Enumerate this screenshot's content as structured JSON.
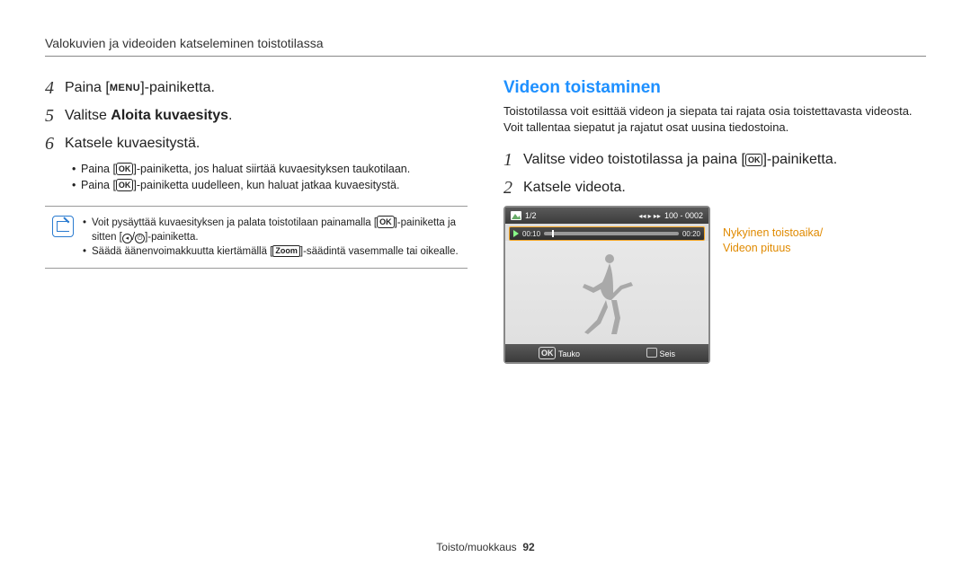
{
  "header": "Valokuvien ja videoiden katseleminen toistotilassa",
  "left": {
    "steps": [
      {
        "num": "4",
        "pre": "Paina [",
        "icon": "MENU",
        "post": "]-painiketta."
      },
      {
        "num": "5",
        "pre": "Valitse ",
        "bold": "Aloita kuvaesitys",
        "post": "."
      },
      {
        "num": "6",
        "text": "Katsele kuvaesitystä."
      }
    ],
    "bullets": [
      {
        "pre": "Paina [",
        "icon": "OK",
        "post": "]-painiketta, jos haluat siirtää kuvaesityksen taukotilaan."
      },
      {
        "pre": "Paina [",
        "icon": "OK",
        "post": "]-painiketta uudelleen, kun haluat jatkaa kuvaesitystä."
      }
    ],
    "notes": [
      {
        "pre": "Voit pysäyttää kuvaesityksen ja palata toistotilaan painamalla [",
        "icon": "OK",
        "mid": "]-painiketta ja sitten [",
        "k1": "◂",
        "sep": "/",
        "k2": "⏻",
        "post": "]-painiketta."
      },
      {
        "pre": "Säädä äänenvoimakkuutta kiertämällä [",
        "zoom": "Zoom",
        "post": "]-säädintä vasemmalle tai oikealle."
      }
    ]
  },
  "right": {
    "section_title": "Videon toistaminen",
    "intro": "Toistotilassa voit esittää videon ja siepata tai rajata osia toistettavasta videosta. Voit tallentaa siepatut ja rajatut osat uusina tiedostoina.",
    "steps": [
      {
        "num": "1",
        "pre": "Valitse video toistotilassa ja paina [",
        "icon": "OK",
        "post": "]-painiketta."
      },
      {
        "num": "2",
        "text": "Katsele videota."
      }
    ],
    "lcd": {
      "counter": "1/2",
      "top_right": "100 - 0002",
      "elapsed": "00:10",
      "total": "00:20",
      "btn_pause": "Tauko",
      "btn_stop": "Seis"
    },
    "callout": "Nykyinen toistoaika/\nVideon pituus"
  },
  "footer": {
    "section": "Toisto/muokkaus",
    "page": "92"
  }
}
